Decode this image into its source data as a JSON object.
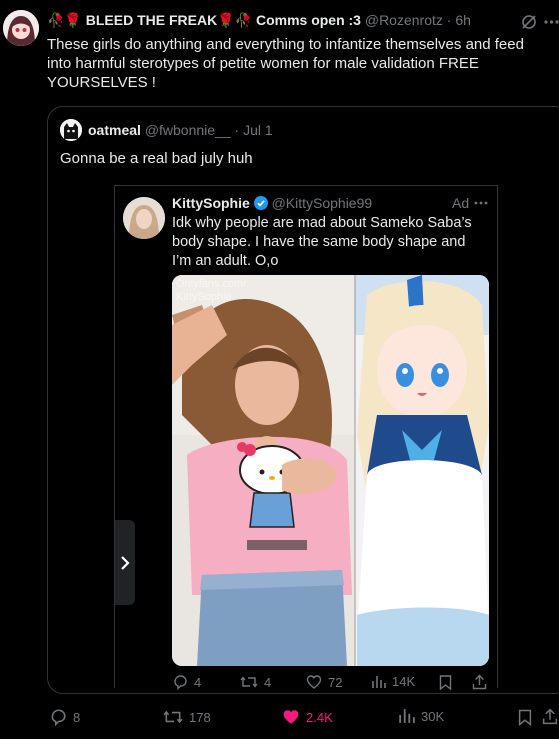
{
  "tweet": {
    "display_name": "🥀🌹 BLEED THE FREAK🌹🥀 Comms open :3",
    "handle": "@Rozenrotz",
    "time": "· 6h",
    "text": "These girls do anything and everything to infantize themselves and feed into harmful sterotypes of petite women for male validation FREE YOURSELVES !",
    "actions": {
      "replies": "8",
      "retweets": "178",
      "likes": "2.4K",
      "views": "30K"
    },
    "like_color": "#f91880"
  },
  "quote": {
    "display_name": "oatmeal",
    "handle": "@fwbonnie__",
    "time": "· Jul 1",
    "text": "Gonna be a real bad july huh"
  },
  "nested": {
    "display_name": "KittySophie",
    "handle": "@KittySophie99",
    "ad_label": "Ad",
    "text": "Idk why people are mad about Sameko Saba’s body shape. I have the same body shape and I’m an adult. O,o",
    "watermark": "Onlyfans.com/ KittySophie",
    "actions": {
      "replies": "4",
      "retweets": "4",
      "likes": "72",
      "views": "14K"
    },
    "verified_color": "#1d9bf0"
  }
}
